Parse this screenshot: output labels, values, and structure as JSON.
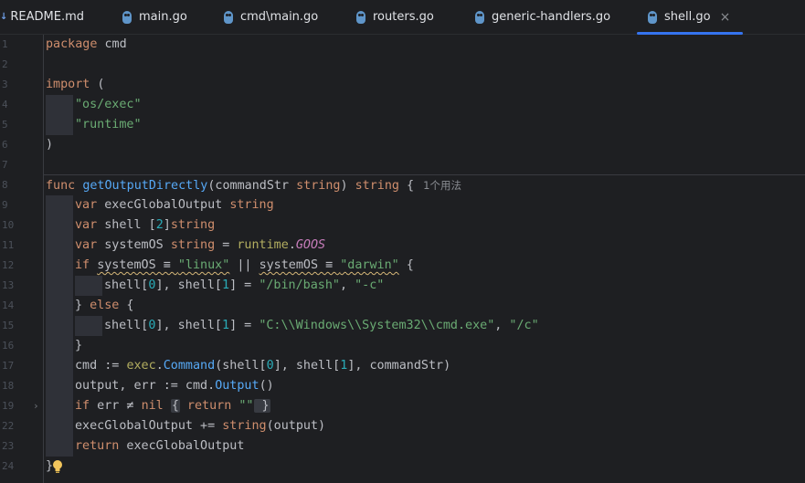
{
  "tabs": [
    {
      "label": "README.md",
      "icon": "markdown-icon",
      "active": false
    },
    {
      "label": "main.go",
      "icon": "go-file-icon",
      "active": false
    },
    {
      "label": "cmd\\main.go",
      "icon": "go-file-icon",
      "active": false
    },
    {
      "label": "routers.go",
      "icon": "go-file-icon",
      "active": false
    },
    {
      "label": "generic-handlers.go",
      "icon": "go-file-icon",
      "active": false
    },
    {
      "label": "shell.go",
      "icon": "go-file-icon",
      "active": true
    }
  ],
  "close_glyph": "×",
  "md_icon_glyph": "↓",
  "usage_hint": "1个用法",
  "line_numbers": [
    "1",
    "2",
    "3",
    "4",
    "5",
    "6",
    "7",
    "8",
    "9",
    "10",
    "11",
    "12",
    "13",
    "14",
    "15",
    "16",
    "17",
    "18",
    "19",
    "22",
    "23",
    "24"
  ],
  "code": {
    "l1_kw": "package",
    "l1_name": "cmd",
    "l3_kw": "import",
    "l3_paren": " (",
    "l4_str": "\"os/exec\"",
    "l5_str": "\"runtime\"",
    "l6": ")",
    "l8_kw": "func",
    "l8_fn": "getOutputDirectly",
    "l8_open": "(commandStr ",
    "l8_type1": "string",
    "l8_close": ") ",
    "l8_type2": "string",
    "l8_brace": " {",
    "l9_kw": "var",
    "l9_name": " execGlobalOutput ",
    "l9_type": "string",
    "l10_kw": "var",
    "l10_name": " shell [",
    "l10_num": "2",
    "l10_close": "]",
    "l10_type": "string",
    "l11_kw": "var",
    "l11_name": " systemOS ",
    "l11_type": "string",
    "l11_eq": " = ",
    "l11_pkg": "runtime",
    "l11_dot": ".",
    "l11_const": "GOOS",
    "l12_kw": "if",
    "l12_a": "systemOS ≡ ",
    "l12_s1": "\"linux\"",
    "l12_or": " || ",
    "l12_b": "systemOS ≡ ",
    "l12_s2": "\"darwin\"",
    "l12_brace": " {",
    "l13_a": "shell[",
    "l13_n0": "0",
    "l13_b": "], shell[",
    "l13_n1": "1",
    "l13_c": "] = ",
    "l13_s1": "\"/bin/bash\"",
    "l13_comma": ", ",
    "l13_s2": "\"-c\"",
    "l14_close": "} ",
    "l14_kw": "else",
    "l14_brace": " {",
    "l15_a": "shell[",
    "l15_n0": "0",
    "l15_b": "], shell[",
    "l15_n1": "1",
    "l15_c": "] = ",
    "l15_s1": "\"C:\\\\Windows\\\\System32\\\\cmd.exe\"",
    "l15_comma": ", ",
    "l15_s2": "\"/c\"",
    "l16": "}",
    "l17_a": "cmd := ",
    "l17_pkg": "exec",
    "l17_dot": ".",
    "l17_fn": "Command",
    "l17_b": "(shell[",
    "l17_n0": "0",
    "l17_c": "], shell[",
    "l17_n1": "1",
    "l17_d": "], commandStr)",
    "l18_a": "output, err := cmd.",
    "l18_fn": "Output",
    "l18_b": "()",
    "l19_kw": "if",
    "l19_a": " err ≠ ",
    "l19_nil": "nil",
    "l19_sp": " ",
    "l19_open": "{",
    "l19_ret": " return ",
    "l19_str": "\"\"",
    "l19_close": " }",
    "l22_a": "execGlobalOutput += ",
    "l22_fn": "string",
    "l22_b": "(output)",
    "l23_kw": "return",
    "l23_a": " execGlobalOutput",
    "l24": "}"
  }
}
